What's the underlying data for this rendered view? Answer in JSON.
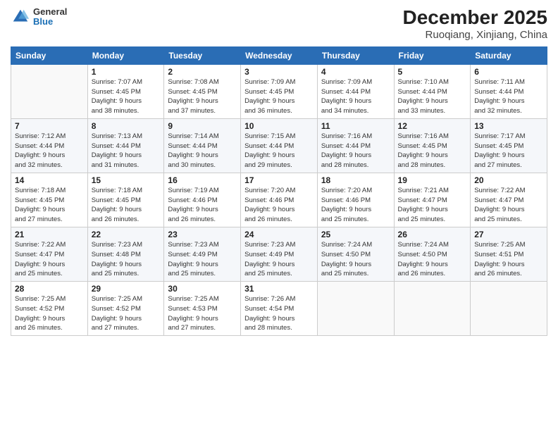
{
  "header": {
    "logo": {
      "general": "General",
      "blue": "Blue"
    },
    "title": "December 2025",
    "subtitle": "Ruoqiang, Xinjiang, China"
  },
  "days_of_week": [
    "Sunday",
    "Monday",
    "Tuesday",
    "Wednesday",
    "Thursday",
    "Friday",
    "Saturday"
  ],
  "weeks": [
    [
      {
        "day": "",
        "info": ""
      },
      {
        "day": "1",
        "info": "Sunrise: 7:07 AM\nSunset: 4:45 PM\nDaylight: 9 hours\nand 38 minutes."
      },
      {
        "day": "2",
        "info": "Sunrise: 7:08 AM\nSunset: 4:45 PM\nDaylight: 9 hours\nand 37 minutes."
      },
      {
        "day": "3",
        "info": "Sunrise: 7:09 AM\nSunset: 4:45 PM\nDaylight: 9 hours\nand 36 minutes."
      },
      {
        "day": "4",
        "info": "Sunrise: 7:09 AM\nSunset: 4:44 PM\nDaylight: 9 hours\nand 34 minutes."
      },
      {
        "day": "5",
        "info": "Sunrise: 7:10 AM\nSunset: 4:44 PM\nDaylight: 9 hours\nand 33 minutes."
      },
      {
        "day": "6",
        "info": "Sunrise: 7:11 AM\nSunset: 4:44 PM\nDaylight: 9 hours\nand 32 minutes."
      }
    ],
    [
      {
        "day": "7",
        "info": "Sunrise: 7:12 AM\nSunset: 4:44 PM\nDaylight: 9 hours\nand 32 minutes."
      },
      {
        "day": "8",
        "info": "Sunrise: 7:13 AM\nSunset: 4:44 PM\nDaylight: 9 hours\nand 31 minutes."
      },
      {
        "day": "9",
        "info": "Sunrise: 7:14 AM\nSunset: 4:44 PM\nDaylight: 9 hours\nand 30 minutes."
      },
      {
        "day": "10",
        "info": "Sunrise: 7:15 AM\nSunset: 4:44 PM\nDaylight: 9 hours\nand 29 minutes."
      },
      {
        "day": "11",
        "info": "Sunrise: 7:16 AM\nSunset: 4:44 PM\nDaylight: 9 hours\nand 28 minutes."
      },
      {
        "day": "12",
        "info": "Sunrise: 7:16 AM\nSunset: 4:45 PM\nDaylight: 9 hours\nand 28 minutes."
      },
      {
        "day": "13",
        "info": "Sunrise: 7:17 AM\nSunset: 4:45 PM\nDaylight: 9 hours\nand 27 minutes."
      }
    ],
    [
      {
        "day": "14",
        "info": "Sunrise: 7:18 AM\nSunset: 4:45 PM\nDaylight: 9 hours\nand 27 minutes."
      },
      {
        "day": "15",
        "info": "Sunrise: 7:18 AM\nSunset: 4:45 PM\nDaylight: 9 hours\nand 26 minutes."
      },
      {
        "day": "16",
        "info": "Sunrise: 7:19 AM\nSunset: 4:46 PM\nDaylight: 9 hours\nand 26 minutes."
      },
      {
        "day": "17",
        "info": "Sunrise: 7:20 AM\nSunset: 4:46 PM\nDaylight: 9 hours\nand 26 minutes."
      },
      {
        "day": "18",
        "info": "Sunrise: 7:20 AM\nSunset: 4:46 PM\nDaylight: 9 hours\nand 25 minutes."
      },
      {
        "day": "19",
        "info": "Sunrise: 7:21 AM\nSunset: 4:47 PM\nDaylight: 9 hours\nand 25 minutes."
      },
      {
        "day": "20",
        "info": "Sunrise: 7:22 AM\nSunset: 4:47 PM\nDaylight: 9 hours\nand 25 minutes."
      }
    ],
    [
      {
        "day": "21",
        "info": "Sunrise: 7:22 AM\nSunset: 4:47 PM\nDaylight: 9 hours\nand 25 minutes."
      },
      {
        "day": "22",
        "info": "Sunrise: 7:23 AM\nSunset: 4:48 PM\nDaylight: 9 hours\nand 25 minutes."
      },
      {
        "day": "23",
        "info": "Sunrise: 7:23 AM\nSunset: 4:49 PM\nDaylight: 9 hours\nand 25 minutes."
      },
      {
        "day": "24",
        "info": "Sunrise: 7:23 AM\nSunset: 4:49 PM\nDaylight: 9 hours\nand 25 minutes."
      },
      {
        "day": "25",
        "info": "Sunrise: 7:24 AM\nSunset: 4:50 PM\nDaylight: 9 hours\nand 25 minutes."
      },
      {
        "day": "26",
        "info": "Sunrise: 7:24 AM\nSunset: 4:50 PM\nDaylight: 9 hours\nand 26 minutes."
      },
      {
        "day": "27",
        "info": "Sunrise: 7:25 AM\nSunset: 4:51 PM\nDaylight: 9 hours\nand 26 minutes."
      }
    ],
    [
      {
        "day": "28",
        "info": "Sunrise: 7:25 AM\nSunset: 4:52 PM\nDaylight: 9 hours\nand 26 minutes."
      },
      {
        "day": "29",
        "info": "Sunrise: 7:25 AM\nSunset: 4:52 PM\nDaylight: 9 hours\nand 27 minutes."
      },
      {
        "day": "30",
        "info": "Sunrise: 7:25 AM\nSunset: 4:53 PM\nDaylight: 9 hours\nand 27 minutes."
      },
      {
        "day": "31",
        "info": "Sunrise: 7:26 AM\nSunset: 4:54 PM\nDaylight: 9 hours\nand 28 minutes."
      },
      {
        "day": "",
        "info": ""
      },
      {
        "day": "",
        "info": ""
      },
      {
        "day": "",
        "info": ""
      }
    ]
  ]
}
